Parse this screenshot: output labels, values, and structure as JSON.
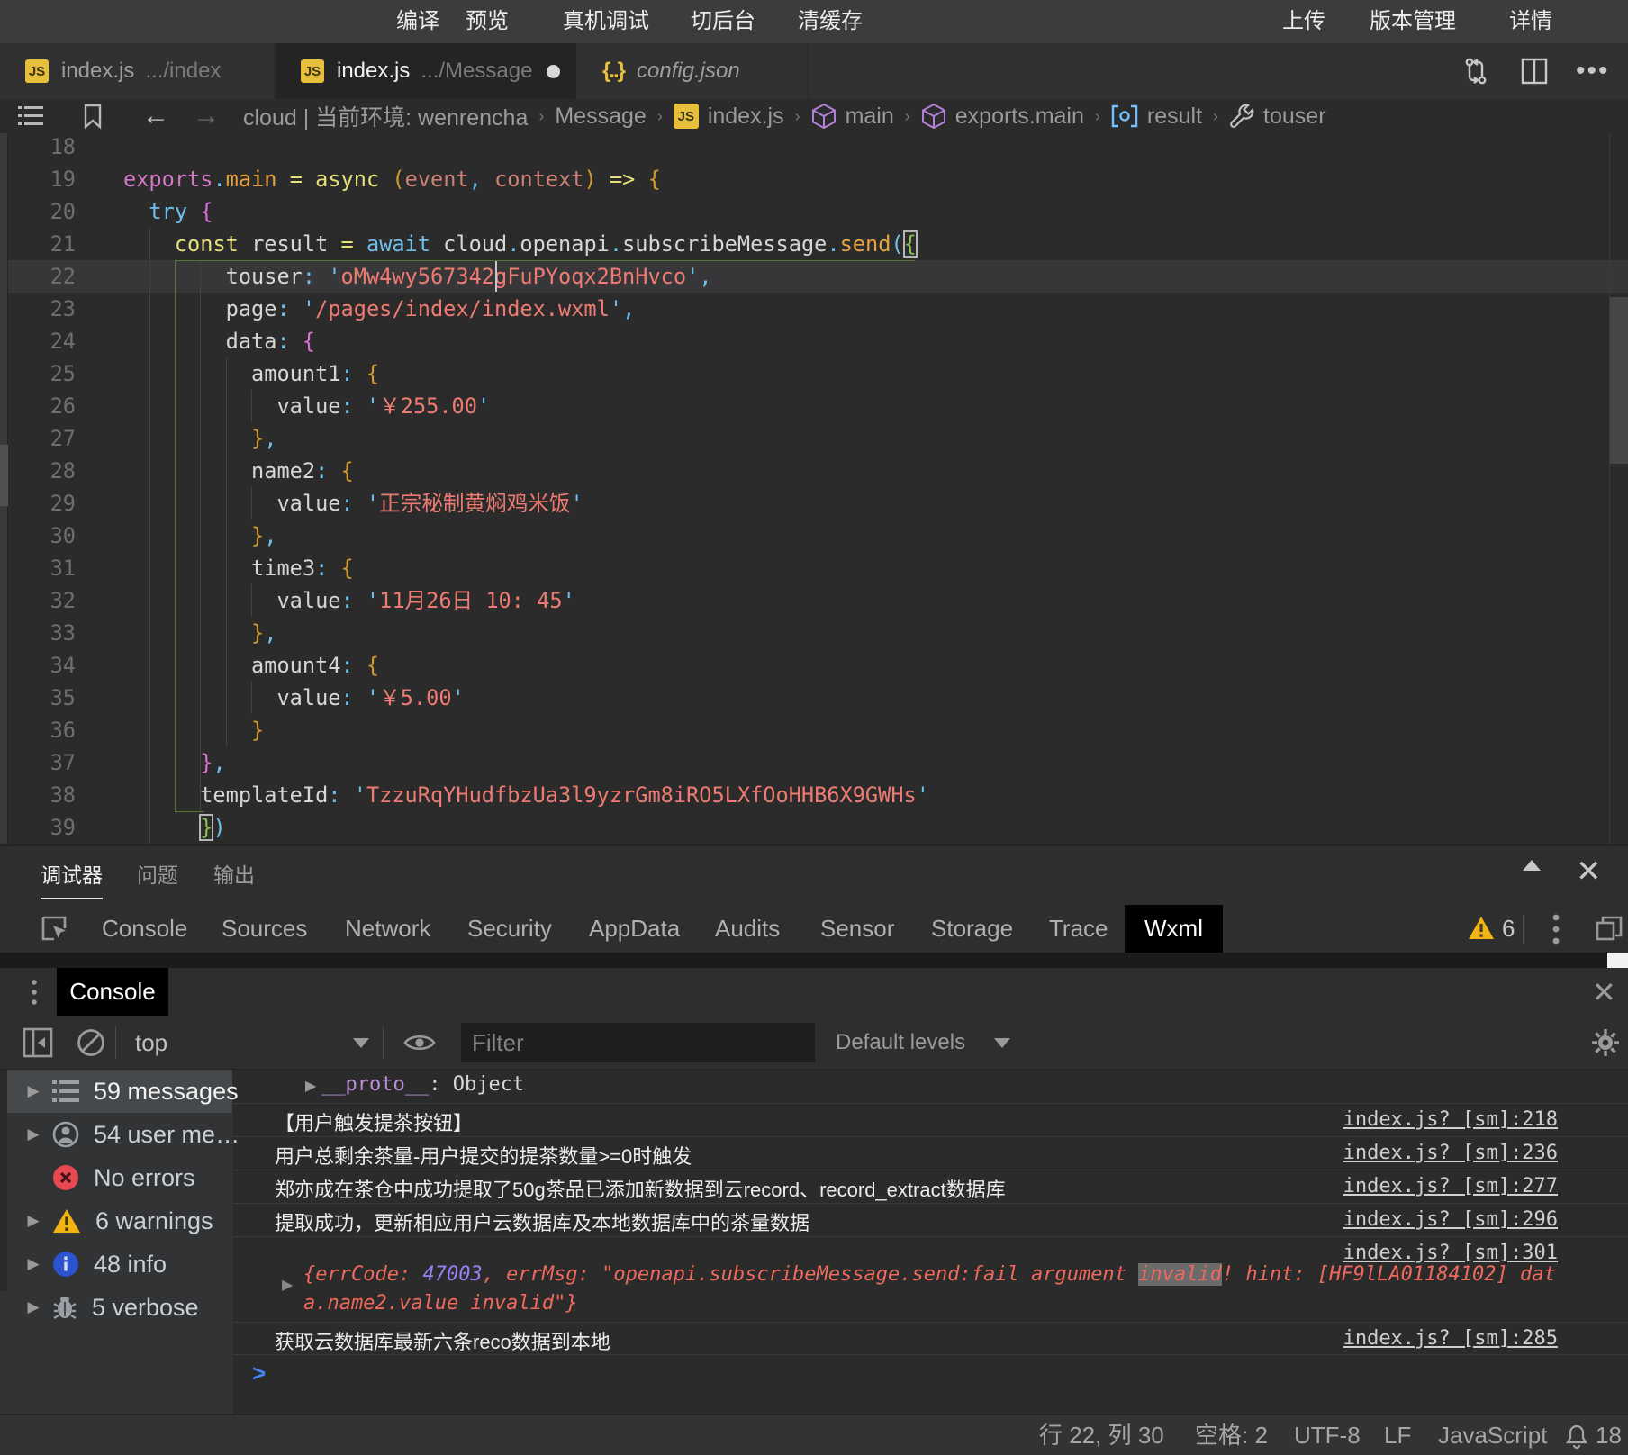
{
  "titlebar": {
    "menu_center": [
      "编译",
      "预览",
      "真机调试",
      "切后台",
      "清缓存"
    ],
    "menu_right": [
      "上传",
      "版本管理",
      "详情"
    ]
  },
  "tabs": [
    {
      "name": "index.js",
      "dir": ".../index",
      "icon": "js",
      "active": false,
      "modified": false,
      "italic": false
    },
    {
      "name": "index.js",
      "dir": ".../Message",
      "icon": "js",
      "active": true,
      "modified": true,
      "italic": false
    },
    {
      "name": "config.json",
      "dir": "",
      "icon": "json",
      "active": false,
      "modified": false,
      "italic": true
    }
  ],
  "breadcrumb": [
    {
      "label": "cloud | 当前环境: wenrencha",
      "icon": ""
    },
    {
      "label": "Message",
      "icon": ""
    },
    {
      "label": "index.js",
      "icon": "js"
    },
    {
      "label": "main",
      "icon": "cube"
    },
    {
      "label": "exports.main",
      "icon": "cube"
    },
    {
      "label": "result",
      "icon": "field"
    },
    {
      "label": "touser",
      "icon": "wrench"
    }
  ],
  "editor": {
    "lines": [
      {
        "n": 18,
        "tokens": []
      },
      {
        "n": 19,
        "tokens": [
          [
            "pk",
            "exports"
          ],
          [
            "b",
            "."
          ],
          [
            "or",
            "main"
          ],
          [
            "w",
            " "
          ],
          [
            "y",
            "="
          ],
          [
            "w",
            " "
          ],
          [
            "y",
            "async"
          ],
          [
            "w",
            " "
          ],
          [
            "g1",
            "("
          ],
          [
            "ro",
            "event"
          ],
          [
            "b",
            ","
          ],
          [
            "w",
            " "
          ],
          [
            "ro",
            "context"
          ],
          [
            "g1",
            ")"
          ],
          [
            "w",
            " "
          ],
          [
            "y",
            "=>"
          ],
          [
            "w",
            " "
          ],
          [
            "g1",
            "{"
          ]
        ]
      },
      {
        "n": 20,
        "tokens": [
          [
            "w",
            "  "
          ],
          [
            "b",
            "try"
          ],
          [
            "w",
            " "
          ],
          [
            "g2",
            "{"
          ]
        ]
      },
      {
        "n": 21,
        "tokens": [
          [
            "w",
            "    "
          ],
          [
            "y",
            "const"
          ],
          [
            "w",
            " result "
          ],
          [
            "y",
            "="
          ],
          [
            "w",
            " "
          ],
          [
            "b",
            "await"
          ],
          [
            "w",
            " cloud"
          ],
          [
            "b",
            "."
          ],
          [
            "w",
            "openapi"
          ],
          [
            "b",
            "."
          ],
          [
            "w",
            "subscribeMessage"
          ],
          [
            "b",
            "."
          ],
          [
            "or",
            "send"
          ],
          [
            "g3",
            "("
          ],
          [
            "gm box",
            "{"
          ]
        ]
      },
      {
        "n": 22,
        "tokens": [
          [
            "w",
            "        touser"
          ],
          [
            "b",
            ":"
          ],
          [
            "w",
            " "
          ],
          [
            "b",
            "'"
          ],
          [
            "s",
            "oMw4wy567342gFuPYoqx2BnHvco"
          ],
          [
            "b",
            "'"
          ],
          [
            "b",
            ","
          ]
        ],
        "current": true
      },
      {
        "n": 23,
        "tokens": [
          [
            "w",
            "        page"
          ],
          [
            "b",
            ":"
          ],
          [
            "w",
            " "
          ],
          [
            "b",
            "'"
          ],
          [
            "s",
            "/pages/index/index.wxml"
          ],
          [
            "b",
            "'"
          ],
          [
            "b",
            ","
          ]
        ]
      },
      {
        "n": 24,
        "tokens": [
          [
            "w",
            "        data"
          ],
          [
            "b",
            ":"
          ],
          [
            "w",
            " "
          ],
          [
            "g2",
            "{"
          ]
        ]
      },
      {
        "n": 25,
        "tokens": [
          [
            "w",
            "          amount1"
          ],
          [
            "b",
            ":"
          ],
          [
            "w",
            " "
          ],
          [
            "g1",
            "{"
          ]
        ]
      },
      {
        "n": 26,
        "tokens": [
          [
            "w",
            "            value"
          ],
          [
            "b",
            ":"
          ],
          [
            "w",
            " "
          ],
          [
            "b",
            "'"
          ],
          [
            "s",
            "￥255.00"
          ],
          [
            "b",
            "'"
          ]
        ]
      },
      {
        "n": 27,
        "tokens": [
          [
            "w",
            "          "
          ],
          [
            "g1",
            "}"
          ],
          [
            "b",
            ","
          ]
        ]
      },
      {
        "n": 28,
        "tokens": [
          [
            "w",
            "          name2"
          ],
          [
            "b",
            ":"
          ],
          [
            "w",
            " "
          ],
          [
            "g1",
            "{"
          ]
        ]
      },
      {
        "n": 29,
        "tokens": [
          [
            "w",
            "            value"
          ],
          [
            "b",
            ":"
          ],
          [
            "w",
            " "
          ],
          [
            "b",
            "'"
          ],
          [
            "s",
            "正宗秘制黄焖鸡米饭"
          ],
          [
            "b",
            "'"
          ]
        ]
      },
      {
        "n": 30,
        "tokens": [
          [
            "w",
            "          "
          ],
          [
            "g1",
            "}"
          ],
          [
            "b",
            ","
          ]
        ]
      },
      {
        "n": 31,
        "tokens": [
          [
            "w",
            "          time3"
          ],
          [
            "b",
            ":"
          ],
          [
            "w",
            " "
          ],
          [
            "g1",
            "{"
          ]
        ]
      },
      {
        "n": 32,
        "tokens": [
          [
            "w",
            "            value"
          ],
          [
            "b",
            ":"
          ],
          [
            "w",
            " "
          ],
          [
            "b",
            "'"
          ],
          [
            "s",
            "11月26日 10: 45"
          ],
          [
            "b",
            "'"
          ]
        ]
      },
      {
        "n": 33,
        "tokens": [
          [
            "w",
            "          "
          ],
          [
            "g1",
            "}"
          ],
          [
            "b",
            ","
          ]
        ]
      },
      {
        "n": 34,
        "tokens": [
          [
            "w",
            "          amount4"
          ],
          [
            "b",
            ":"
          ],
          [
            "w",
            " "
          ],
          [
            "g1",
            "{"
          ]
        ]
      },
      {
        "n": 35,
        "tokens": [
          [
            "w",
            "            value"
          ],
          [
            "b",
            ":"
          ],
          [
            "w",
            " "
          ],
          [
            "b",
            "'"
          ],
          [
            "s",
            "￥5.00"
          ],
          [
            "b",
            "'"
          ]
        ]
      },
      {
        "n": 36,
        "tokens": [
          [
            "w",
            "          "
          ],
          [
            "g1",
            "}"
          ]
        ]
      },
      {
        "n": 37,
        "tokens": [
          [
            "w",
            "      "
          ],
          [
            "g2",
            "}"
          ],
          [
            "b",
            ","
          ]
        ]
      },
      {
        "n": 38,
        "tokens": [
          [
            "w",
            "      templateId"
          ],
          [
            "b",
            ":"
          ],
          [
            "w",
            " "
          ],
          [
            "b",
            "'"
          ],
          [
            "s",
            "TzzuRqYHudfbzUa3l9yzrGm8iRO5LXfOoHHB6X9GWHs"
          ],
          [
            "b",
            "'"
          ]
        ]
      },
      {
        "n": 39,
        "tokens": [
          [
            "w",
            "      "
          ],
          [
            "gm box",
            "}"
          ],
          [
            "g3",
            ")"
          ]
        ]
      }
    ]
  },
  "debugger": {
    "panel_tabs": [
      {
        "label": "调试器",
        "active": true
      },
      {
        "label": "问题",
        "active": false
      },
      {
        "label": "输出",
        "active": false
      }
    ],
    "devtools_tabs": [
      {
        "label": "Console",
        "active": false
      },
      {
        "label": "Sources",
        "active": false
      },
      {
        "label": "Network",
        "active": false
      },
      {
        "label": "Security",
        "active": false
      },
      {
        "label": "AppData",
        "active": false
      },
      {
        "label": "Audits",
        "active": false
      },
      {
        "label": "Sensor",
        "active": false
      },
      {
        "label": "Storage",
        "active": false
      },
      {
        "label": "Trace",
        "active": false
      },
      {
        "label": "Wxml",
        "active": true
      }
    ],
    "warning_count": "6"
  },
  "console": {
    "drawer_tab": "Console",
    "context_selector": "top",
    "filter_placeholder": "Filter",
    "levels_selector": "Default levels",
    "sidebar": [
      {
        "icon": "list",
        "label": "59 messages",
        "arrow": true,
        "selected": true
      },
      {
        "icon": "user",
        "label": "54 user me…",
        "arrow": true,
        "selected": false
      },
      {
        "icon": "error",
        "label": "No errors",
        "arrow": false,
        "selected": false
      },
      {
        "icon": "warning",
        "label": "6 warnings",
        "arrow": true,
        "selected": false
      },
      {
        "icon": "info",
        "label": "48 info",
        "arrow": true,
        "selected": false
      },
      {
        "icon": "verbose",
        "label": "5 verbose",
        "arrow": true,
        "selected": false
      }
    ],
    "proto_row": {
      "name": "__proto__",
      "sep": ": ",
      "value": "Object"
    },
    "messages": [
      {
        "text": "【用户触发提茶按钮】",
        "link": "index.js? [sm]:218"
      },
      {
        "text": "用户总剩余茶量-用户提交的提茶数量>=0时触发",
        "link": "index.js? [sm]:236"
      },
      {
        "text": "郑亦成在茶仓中成功提取了50g茶品已添加新数据到云record、record_extract数据库",
        "link": "index.js? [sm]:277"
      },
      {
        "text": "提取成功，更新相应用户云数据库及本地数据库中的茶量数据",
        "link": "index.js? [sm]:296"
      }
    ],
    "error_row": {
      "link": "index.js? [sm]:301",
      "line1_pre": "{errCode: ",
      "code": "47003",
      "line1_mid": ", errMsg: \"openapi.subscribeMessage.send:fail argument ",
      "highlight": "invalid",
      "line1_post": "! hint: [HF9lLA01184102] dat",
      "line2": "a.name2.value invalid\"}"
    },
    "last_message": {
      "text": "获取云数据库最新六条reco数据到本地",
      "link": "index.js? [sm]:285"
    },
    "prompt": ">"
  },
  "statusbar": {
    "items": [
      "行 22, 列 30",
      "空格: 2",
      "UTF-8",
      "LF",
      "JavaScript"
    ],
    "bell_count": "18"
  }
}
